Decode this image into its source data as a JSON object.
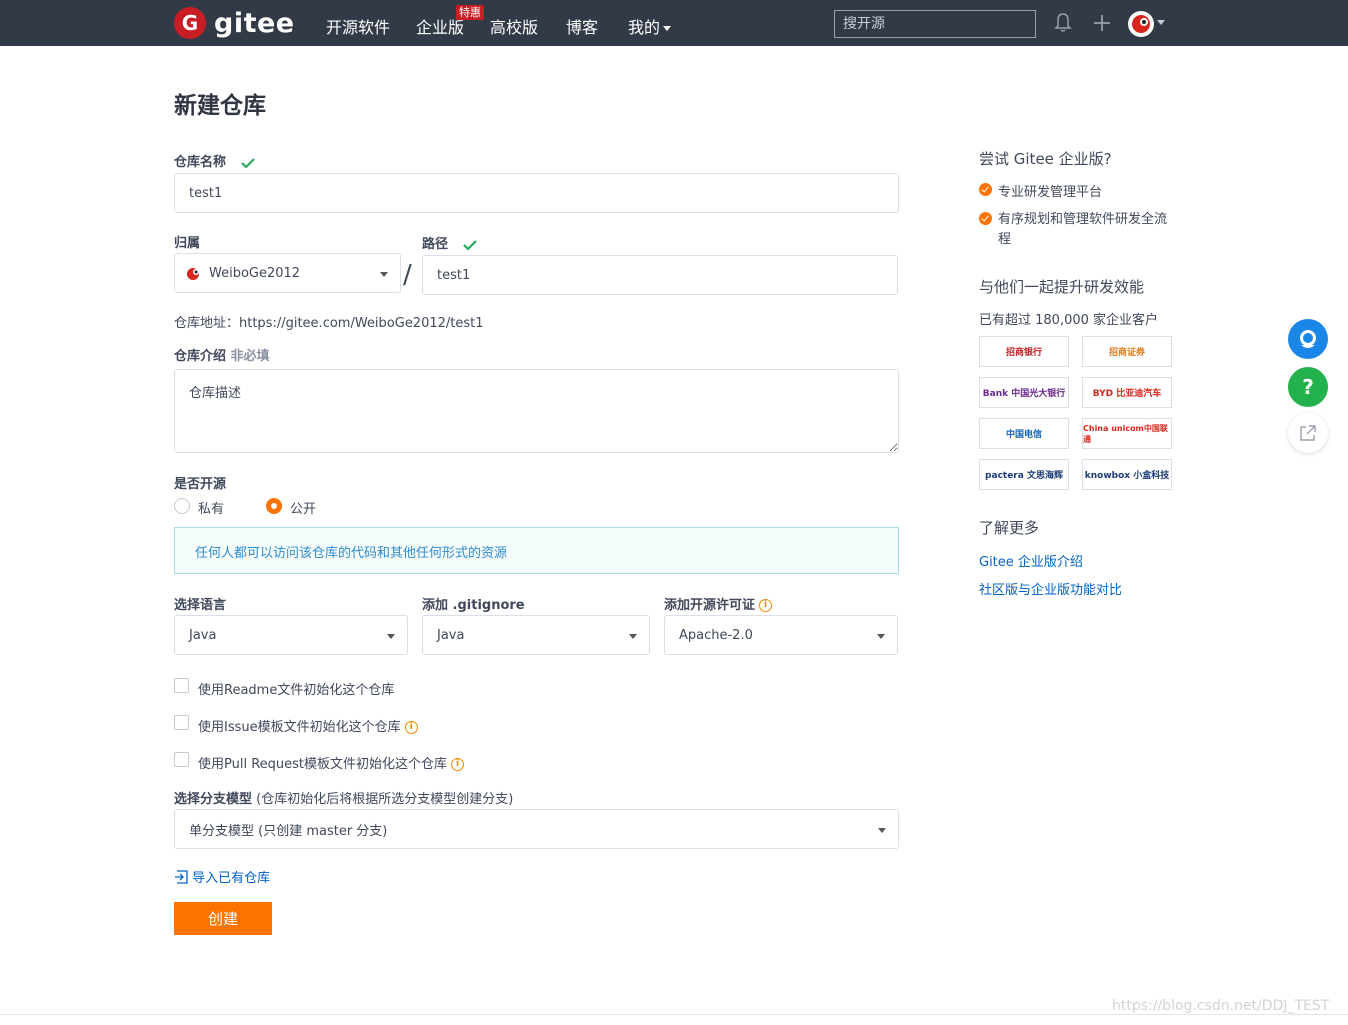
{
  "nav": {
    "logo_mark": "G",
    "logo_text": "gitee",
    "items": [
      "开源软件",
      "企业版",
      "高校版",
      "博客",
      "我的"
    ],
    "badge": "特惠",
    "search_placeholder": "搜开源"
  },
  "page_title": "新建仓库",
  "form": {
    "repo_name_label": "仓库名称",
    "repo_name_value": "test1",
    "owner_label": "归属",
    "owner_value": "WeiboGe2012",
    "path_label": "路径",
    "path_value": "test1",
    "repo_address": "仓库地址：https://gitee.com/WeiboGe2012/test1",
    "desc_label": "仓库介绍",
    "desc_optional": "非必填",
    "desc_placeholder": "仓库描述",
    "open_source_label": "是否开源",
    "private_label": "私有",
    "public_label": "公开",
    "public_info": "任何人都可以访问该仓库的代码和其他任何形式的资源",
    "language_label": "选择语言",
    "language_value": "Java",
    "gitignore_label": "添加 .gitignore",
    "gitignore_value": "Java",
    "license_label": "添加开源许可证",
    "license_value": "Apache-2.0",
    "readme_label": "使用Readme文件初始化这个仓库",
    "issue_label": "使用Issue模板文件初始化这个仓库",
    "pr_label": "使用Pull Request模板文件初始化这个仓库",
    "branch_label": "选择分支模型",
    "branch_hint": "(仓库初始化后将根据所选分支模型创建分支)",
    "branch_value": "单分支模型 (只创建 master 分支)",
    "import_label": "导入已有仓库",
    "create_button": "创建"
  },
  "sidebar": {
    "try_title": "尝试 Gitee 企业版?",
    "bullet1": "专业研发管理平台",
    "bullet2": "有序规划和管理软件研发全流程",
    "together_title": "与他们一起提升研发效能",
    "customers": "已有超过 180,000 家企业客户",
    "logos": [
      "招商银行",
      "招商证券",
      "Bank 中国光大银行",
      "BYD 比亚迪汽车",
      "中国电信",
      "China unicom中国联通",
      "pactera 文思海辉",
      "knowbox 小盒科技"
    ],
    "learn_title": "了解更多",
    "link1": "Gitee 企业版介绍",
    "link2": "社区版与企业版功能对比"
  },
  "fab": {
    "help": "?"
  },
  "watermark": "https://blog.csdn.net/DDJ_TEST",
  "colors": {
    "accent": "#fe7300",
    "brand": "#c71d23",
    "link": "#0063c6",
    "nav_bg": "#333a47"
  }
}
